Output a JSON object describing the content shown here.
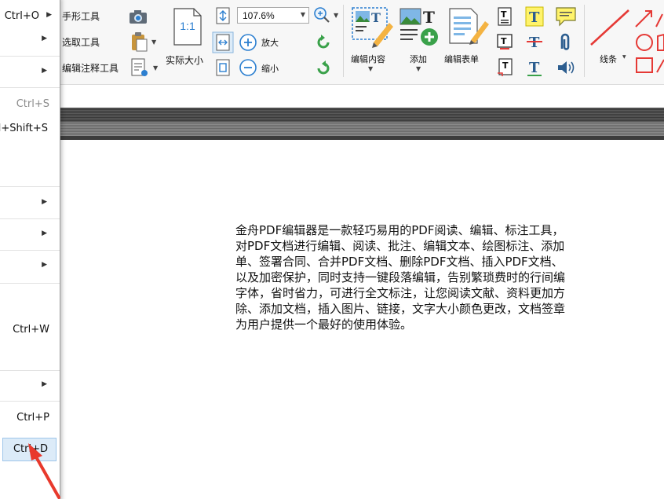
{
  "ribbon": {
    "hand_tool": "手形工具",
    "select_tool": "选取工具",
    "edit_annotation_tool": "编辑注释工具",
    "actual_size": "实际大小",
    "actual_size_icon_text": "1:1",
    "zoom_value": "107.6%",
    "zoom_in": "放大",
    "zoom_out": "缩小",
    "edit_content": "编辑内容",
    "add": "添加",
    "edit_form": "编辑表单",
    "lines": "线条"
  },
  "file_menu": {
    "items": [
      {
        "shortcut": "Ctrl+O",
        "has_submenu": true
      },
      {
        "shortcut": "",
        "has_submenu": true
      },
      {
        "shortcut": "",
        "has_submenu": true
      },
      {
        "shortcut": "Ctrl+S",
        "disabled": true
      },
      {
        "shortcut": "Ctrl+Shift+S"
      },
      {
        "shortcut": "",
        "has_submenu": true
      },
      {
        "shortcut": "",
        "has_submenu": true
      },
      {
        "shortcut": "",
        "has_submenu": true
      },
      {
        "shortcut": "Ctrl+W"
      },
      {
        "shortcut": "",
        "has_submenu": true
      },
      {
        "shortcut": "Ctrl+P"
      },
      {
        "shortcut": "Ctrl+D",
        "highlighted": true
      }
    ]
  },
  "document": {
    "lines": [
      "金舟PDF编辑器是一款轻巧易用的PDF阅读、编辑、标注工具，",
      "对PDF文档进行编辑、阅读、批注、编辑文本、绘图标注、添加",
      "单、签署合同、合并PDF文档、删除PDF文档、插入PDF文档、",
      "以及加密保护，同时支持一键段落编辑，告别繁琐费时的行间编",
      "字体，省时省力，可进行全文标注，让您阅读文献、资料更加方",
      "除、添加文档，插入图片、链接，文字大小颜色更改，文档签章",
      "为用户提供一个最好的使用体验。"
    ]
  },
  "colors": {
    "accent_blue": "#2c7fd0",
    "highlight": "#dcebf8",
    "annotation_red": "#e53935",
    "arrow_red": "#e8392c",
    "toolbar_dark": "#3a3a3a"
  }
}
